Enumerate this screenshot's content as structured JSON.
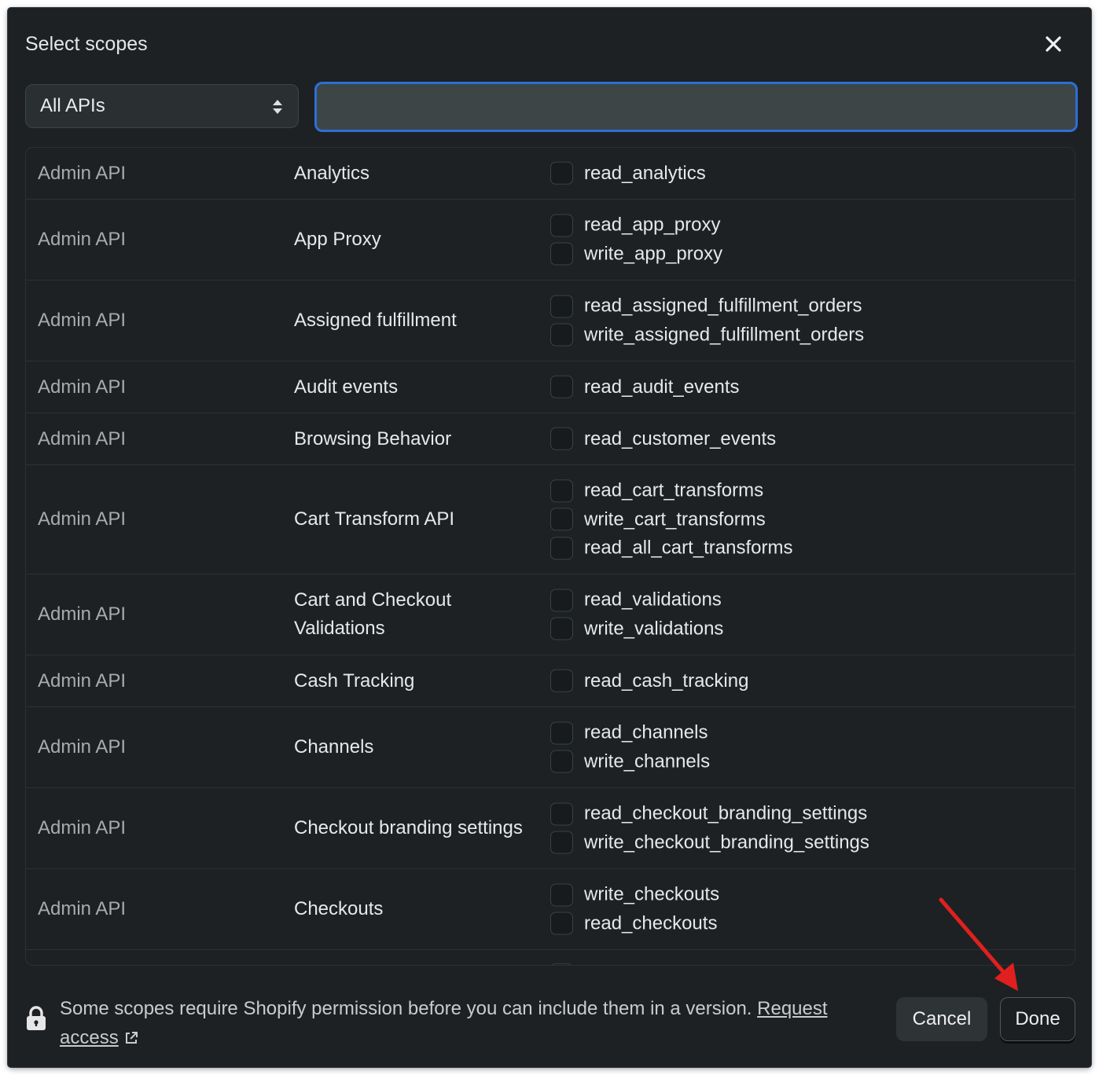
{
  "dialog": {
    "title": "Select scopes",
    "close_icon": "close-icon"
  },
  "filter": {
    "api_select_value": "All APIs",
    "search_value": ""
  },
  "rows": [
    {
      "api": "Admin API",
      "resource": "Analytics",
      "scopes": [
        "read_analytics"
      ]
    },
    {
      "api": "Admin API",
      "resource": "App Proxy",
      "scopes": [
        "read_app_proxy",
        "write_app_proxy"
      ]
    },
    {
      "api": "Admin API",
      "resource": "Assigned fulfillment",
      "scopes": [
        "read_assigned_fulfillment_orders",
        "write_assigned_fulfillment_orders"
      ]
    },
    {
      "api": "Admin API",
      "resource": "Audit events",
      "scopes": [
        "read_audit_events"
      ]
    },
    {
      "api": "Admin API",
      "resource": "Browsing Behavior",
      "scopes": [
        "read_customer_events"
      ]
    },
    {
      "api": "Admin API",
      "resource": "Cart Transform API",
      "scopes": [
        "read_cart_transforms",
        "write_cart_transforms",
        "read_all_cart_transforms"
      ]
    },
    {
      "api": "Admin API",
      "resource": "Cart and Checkout Validations",
      "scopes": [
        "read_validations",
        "write_validations"
      ]
    },
    {
      "api": "Admin API",
      "resource": "Cash Tracking",
      "scopes": [
        "read_cash_tracking"
      ]
    },
    {
      "api": "Admin API",
      "resource": "Channels",
      "scopes": [
        "read_channels",
        "write_channels"
      ]
    },
    {
      "api": "Admin API",
      "resource": "Checkout branding settings",
      "scopes": [
        "read_checkout_branding_settings",
        "write_checkout_branding_settings"
      ]
    },
    {
      "api": "Admin API",
      "resource": "Checkouts",
      "scopes": [
        "write_checkouts",
        "read_checkouts"
      ]
    }
  ],
  "footer": {
    "lock_icon": "lock-icon",
    "notice": "Some scopes require Shopify permission before you can include them in a version.",
    "link_part1": "Request",
    "link_part2": "access",
    "external_icon": "external-link-icon",
    "cancel_label": "Cancel",
    "done_label": "Done"
  },
  "colors": {
    "modal_bg": "#1d2124",
    "focus_ring": "#2e6fd6",
    "annotation_arrow": "#e0201f"
  }
}
